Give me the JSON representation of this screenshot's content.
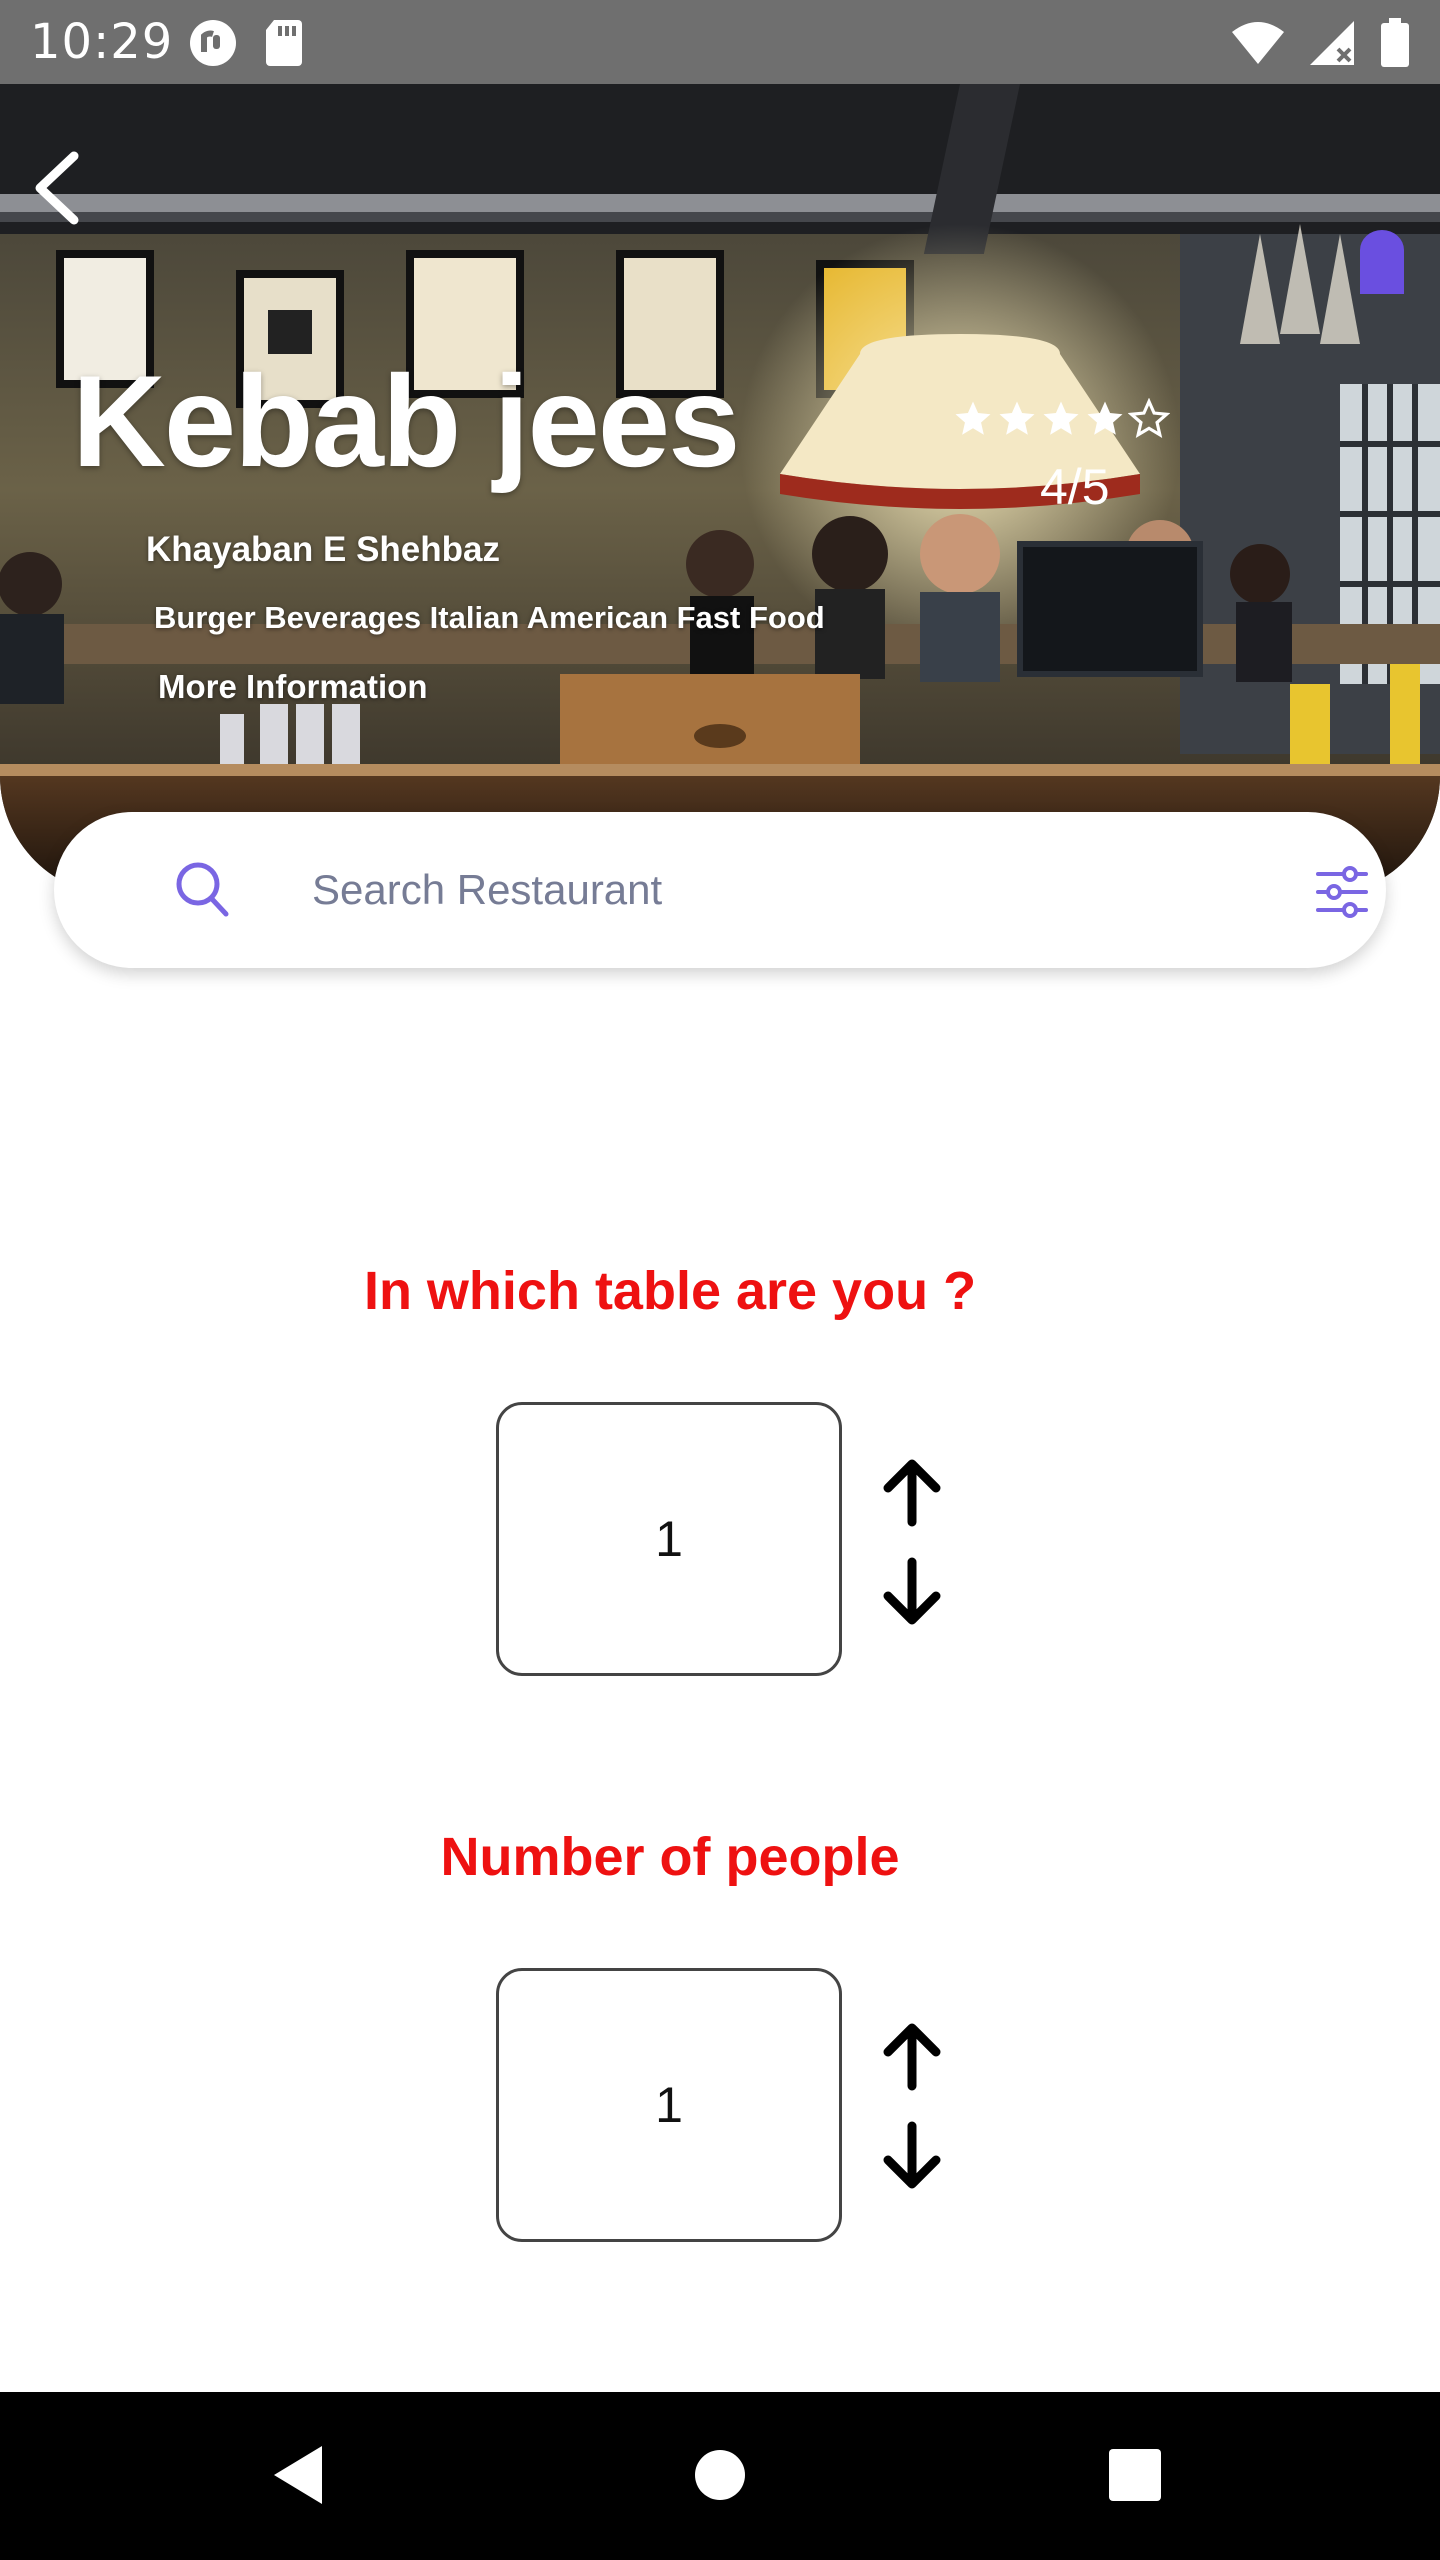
{
  "status_bar": {
    "time": "10:29",
    "icons": [
      "pocket-casts-icon",
      "sd-card-icon",
      "wifi-icon",
      "signal-icon",
      "battery-icon"
    ]
  },
  "hero": {
    "back_icon": "back-arrow-icon",
    "bookmark_icon": "bookmark-icon",
    "restaurant_name": "Kebab jees",
    "rating": {
      "value": 4,
      "max": 5,
      "label": "4/5"
    },
    "address": "Khayaban E Shehbaz",
    "cuisines": "Burger Beverages Italian American Fast Food",
    "more_info": "More Information"
  },
  "search": {
    "placeholder": "Search Restaurant",
    "value": "",
    "search_icon": "search-icon",
    "filter_icon": "filter-sliders-icon"
  },
  "table_selector": {
    "heading": "In which table are you ?",
    "value": "1",
    "up_icon": "arrow-up-icon",
    "down_icon": "arrow-down-icon"
  },
  "people_selector": {
    "heading": "Number of people",
    "value": "1",
    "up_icon": "arrow-up-icon",
    "down_icon": "arrow-down-icon"
  },
  "nav_bar": {
    "buttons": [
      "back-triangle-icon",
      "home-circle-icon",
      "recents-square-icon"
    ]
  },
  "colors": {
    "accent_purple": "#6a4fe0",
    "heading_red": "#ee1111",
    "status_bar": "#6f6f6f",
    "nav_bar": "#000000"
  }
}
